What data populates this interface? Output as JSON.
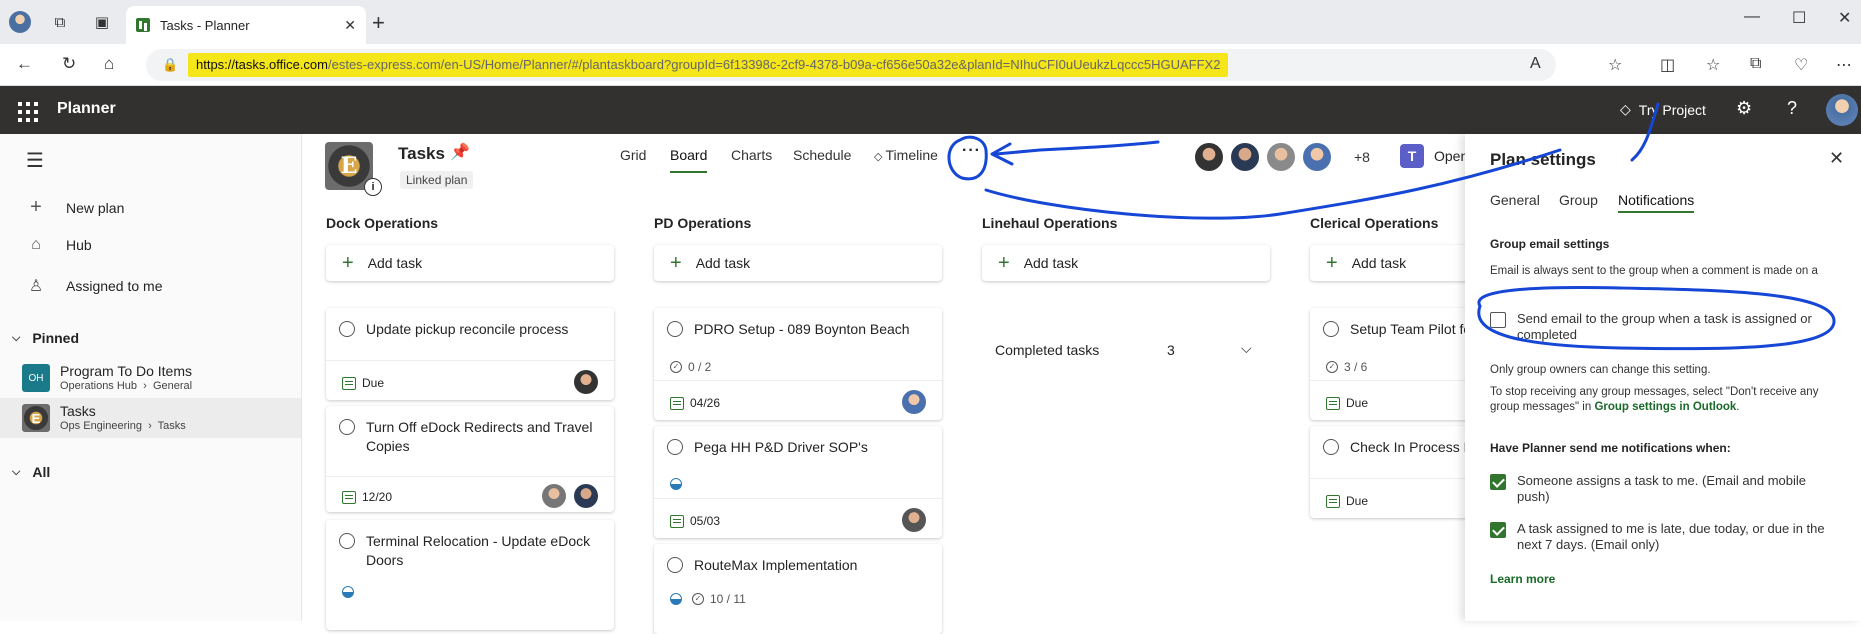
{
  "browser": {
    "tab_title": "Tasks - Planner",
    "url_host": "https://tasks.office.com",
    "url_path": "/estes-express.com/en-US/Home/Planner/#/plantaskboard?groupId=6f13398c-2cf9-4378-b09a-cf656e50a32e&planId=NIhuCFI0uUeukzLqccc5HGUAFFX2"
  },
  "header": {
    "app_name": "Planner",
    "try_project": "Try Project"
  },
  "leftnav": {
    "new_plan": "New plan",
    "hub": "Hub",
    "assigned": "Assigned to me",
    "pinned_label": "Pinned",
    "all_label": "All",
    "pinned": [
      {
        "title": "Program To Do Items",
        "path1": "Operations Hub",
        "path2": "General",
        "icon_text": "OH"
      },
      {
        "title": "Tasks",
        "path1": "Ops Engineering",
        "path2": "Tasks"
      }
    ]
  },
  "board": {
    "title": "Tasks",
    "linked": "Linked plan",
    "views": [
      "Grid",
      "Board",
      "Charts",
      "Schedule",
      "Timeline"
    ],
    "more": "···",
    "member_extra": "+8",
    "teams_label": "Open"
  },
  "buckets": {
    "dock": {
      "title": "Dock Operations",
      "add": "Add task",
      "cards": [
        {
          "title": "Update pickup reconcile process",
          "due": "Due"
        },
        {
          "title": "Turn Off eDock Redirects and Travel Copies",
          "due": "12/20"
        },
        {
          "title": "Terminal Relocation - Update eDock Doors"
        }
      ]
    },
    "pd": {
      "title": "PD Operations",
      "add": "Add task",
      "cards": [
        {
          "title": "PDRO Setup - 089 Boynton Beach",
          "check": "0 / 2",
          "due": "04/26"
        },
        {
          "title": "Pega HH P&D Driver SOP's",
          "due": "05/03"
        },
        {
          "title": "RouteMax Implementation",
          "check": "10 / 11"
        }
      ]
    },
    "linehaul": {
      "title": "Linehaul Operations",
      "add": "Add task",
      "completed": "Completed tasks",
      "completed_count": "3"
    },
    "clerical": {
      "title": "Clerical Operations",
      "add": "Add task",
      "cards": [
        {
          "title": "Setup Team Pilot fo",
          "check": "3 / 6",
          "due": "Due"
        },
        {
          "title": "Check In Process D",
          "due": "Due"
        }
      ]
    }
  },
  "panel": {
    "title": "Plan settings",
    "tabs": [
      "General",
      "Group",
      "Notifications"
    ],
    "group_email_heading": "Group email settings",
    "always_text": "Email is always sent to the group when a comment is made on a task.",
    "send_email": "Send email to the group when a task is assigned or completed",
    "owners_text": "Only group owners can change this setting.",
    "stop_text": "To stop receiving any group messages, select \"Don't receive any group messages\" in",
    "stop_link": "Group settings in Outlook",
    "notify_heading": "Have Planner send me notifications when:",
    "notify1": "Someone assigns a task to me. (Email and mobile push)",
    "notify2": "A task assigned to me is late, due today, or due in the next 7 days. (Email only)",
    "learn_more": "Learn more"
  },
  "colors": {
    "accent": "#31752f",
    "header_bg": "#323130",
    "highlight": "#f5e61a",
    "annotation": "#1546d6"
  }
}
